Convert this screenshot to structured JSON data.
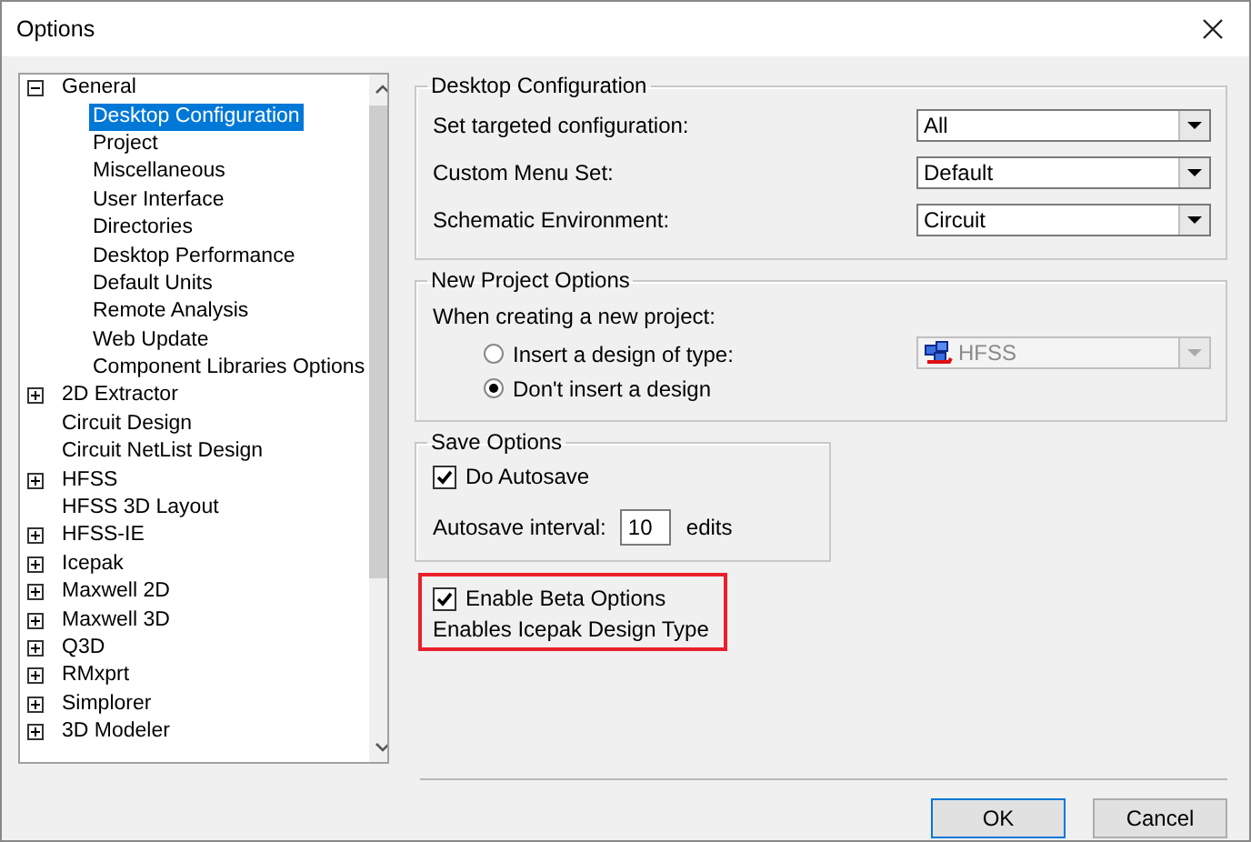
{
  "window": {
    "title": "Options"
  },
  "tree": [
    {
      "label": "General",
      "expanded": true,
      "children": [
        {
          "label": "Desktop Configuration",
          "selected": true
        },
        {
          "label": "Project",
          "selected": false
        },
        {
          "label": "Miscellaneous",
          "selected": false
        },
        {
          "label": "User Interface",
          "selected": false
        },
        {
          "label": "Directories",
          "selected": false
        },
        {
          "label": "Desktop Performance",
          "selected": false
        },
        {
          "label": "Default Units",
          "selected": false
        },
        {
          "label": "Remote Analysis",
          "selected": false
        },
        {
          "label": "Web Update",
          "selected": false
        },
        {
          "label": "Component Libraries Options",
          "selected": false
        }
      ],
      "selected": false
    },
    {
      "label": "2D Extractor",
      "expanded": false,
      "selected": false
    },
    {
      "label": "Circuit Design",
      "selected": false
    },
    {
      "label": "Circuit NetList Design",
      "selected": false
    },
    {
      "label": "HFSS",
      "expanded": false,
      "selected": false
    },
    {
      "label": "HFSS 3D Layout",
      "selected": false
    },
    {
      "label": "HFSS-IE",
      "expanded": false,
      "selected": false
    },
    {
      "label": "Icepak",
      "expanded": false,
      "selected": false
    },
    {
      "label": "Maxwell 2D",
      "expanded": false,
      "selected": false
    },
    {
      "label": "Maxwell 3D",
      "expanded": false,
      "selected": false
    },
    {
      "label": "Q3D",
      "expanded": false,
      "selected": false
    },
    {
      "label": "RMxprt",
      "expanded": false,
      "selected": false
    },
    {
      "label": "Simplorer",
      "expanded": false,
      "selected": false
    },
    {
      "label": "3D Modeler",
      "expanded": false,
      "selected": false
    }
  ],
  "desktop_configuration": {
    "title": "Desktop Configuration",
    "fields": [
      {
        "label": "Set targeted configuration:",
        "value": "All"
      },
      {
        "label": "Custom Menu Set:",
        "value": "Default"
      },
      {
        "label": "Schematic Environment:",
        "value": "Circuit"
      }
    ]
  },
  "new_project_options": {
    "title": "New Project Options",
    "prompt": "When creating a new project:",
    "options": [
      {
        "label": "Insert a design of type:",
        "selected": false
      },
      {
        "label": "Don't insert a design",
        "selected": true
      }
    ],
    "design_type": {
      "value": "HFSS",
      "disabled": true
    }
  },
  "save_options": {
    "title": "Save Options",
    "autosave": {
      "label": "Do Autosave",
      "checked": true
    },
    "interval_label": "Autosave interval:",
    "interval": "10",
    "unit": "edits"
  },
  "beta": {
    "label": "Enable Beta Options",
    "checked": true,
    "note": "Enables Icepak Design Type"
  },
  "buttons": [
    "OK",
    "Cancel"
  ]
}
